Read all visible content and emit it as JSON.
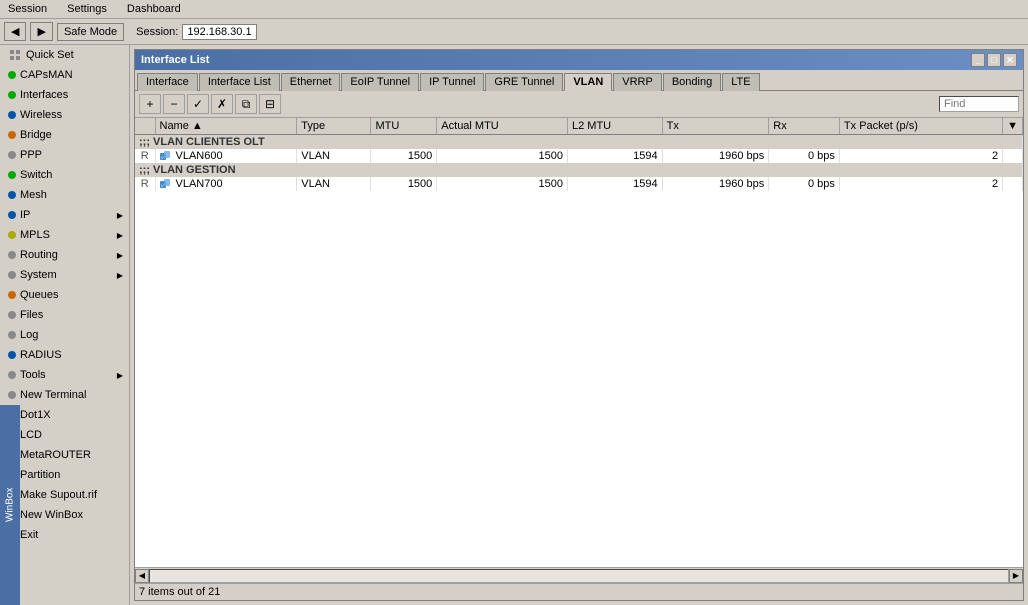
{
  "menuBar": {
    "items": [
      "Session",
      "Settings",
      "Dashboard"
    ]
  },
  "toolbar": {
    "backBtn": "◀",
    "forwardBtn": "▶",
    "safeModeBtn": "Safe Mode",
    "sessionLabel": "Session:",
    "sessionValue": "192.168.30.1"
  },
  "sidebar": {
    "items": [
      {
        "id": "quick-set",
        "label": "Quick Set",
        "color": "gray",
        "hasArrow": false
      },
      {
        "id": "capsman",
        "label": "CAPsMAN",
        "color": "green",
        "hasArrow": false
      },
      {
        "id": "interfaces",
        "label": "Interfaces",
        "color": "green",
        "hasArrow": false
      },
      {
        "id": "wireless",
        "label": "Wireless",
        "color": "blue",
        "hasArrow": false
      },
      {
        "id": "bridge",
        "label": "Bridge",
        "color": "orange",
        "hasArrow": false
      },
      {
        "id": "ppp",
        "label": "PPP",
        "color": "gray",
        "hasArrow": false
      },
      {
        "id": "switch",
        "label": "Switch",
        "color": "green",
        "hasArrow": false
      },
      {
        "id": "mesh",
        "label": "Mesh",
        "color": "blue",
        "hasArrow": false
      },
      {
        "id": "ip",
        "label": "IP",
        "color": "blue",
        "hasArrow": true
      },
      {
        "id": "mpls",
        "label": "MPLS",
        "color": "yellow",
        "hasArrow": true
      },
      {
        "id": "routing",
        "label": "Routing",
        "color": "gray",
        "hasArrow": true
      },
      {
        "id": "system",
        "label": "System",
        "color": "gray",
        "hasArrow": true
      },
      {
        "id": "queues",
        "label": "Queues",
        "color": "orange",
        "hasArrow": false
      },
      {
        "id": "files",
        "label": "Files",
        "color": "gray",
        "hasArrow": false
      },
      {
        "id": "log",
        "label": "Log",
        "color": "gray",
        "hasArrow": false
      },
      {
        "id": "radius",
        "label": "RADIUS",
        "color": "blue",
        "hasArrow": false
      },
      {
        "id": "tools",
        "label": "Tools",
        "color": "gray",
        "hasArrow": true
      },
      {
        "id": "new-terminal",
        "label": "New Terminal",
        "color": "gray",
        "hasArrow": false
      },
      {
        "id": "dot1x",
        "label": "Dot1X",
        "color": "gray",
        "hasArrow": false
      },
      {
        "id": "lcd",
        "label": "LCD",
        "color": "gray",
        "hasArrow": false
      },
      {
        "id": "metarouter",
        "label": "MetaROUTER",
        "color": "gray",
        "hasArrow": false
      },
      {
        "id": "partition",
        "label": "Partition",
        "color": "gray",
        "hasArrow": false
      },
      {
        "id": "make-supout",
        "label": "Make Supout.rif",
        "color": "gray",
        "hasArrow": false
      },
      {
        "id": "new-winbox",
        "label": "New WinBox",
        "color": "blue",
        "hasArrow": false
      },
      {
        "id": "exit",
        "label": "Exit",
        "color": "red",
        "hasArrow": false
      }
    ],
    "winboxLabel": "WinBox"
  },
  "window": {
    "title": "Interface List",
    "tabs": [
      {
        "id": "interface",
        "label": "Interface"
      },
      {
        "id": "interface-list",
        "label": "Interface List"
      },
      {
        "id": "ethernet",
        "label": "Ethernet"
      },
      {
        "id": "eoip-tunnel",
        "label": "EoIP Tunnel"
      },
      {
        "id": "ip-tunnel",
        "label": "IP Tunnel"
      },
      {
        "id": "gre-tunnel",
        "label": "GRE Tunnel"
      },
      {
        "id": "vlan",
        "label": "VLAN",
        "active": true
      },
      {
        "id": "vrrp",
        "label": "VRRP"
      },
      {
        "id": "bonding",
        "label": "Bonding"
      },
      {
        "id": "lte",
        "label": "LTE"
      }
    ],
    "toolbar": {
      "addBtn": "+",
      "removeBtn": "−",
      "enableBtn": "✓",
      "disableBtn": "✗",
      "copyBtn": "⧉",
      "filterBtn": "⊟",
      "findPlaceholder": "Find"
    },
    "table": {
      "columns": [
        "",
        "Name",
        "Type",
        "MTU",
        "Actual MTU",
        "L2 MTU",
        "Tx",
        "Rx",
        "Tx Packet (p/s)",
        ""
      ],
      "sections": [
        {
          "header": ";;; VLAN CLIENTES OLT",
          "rows": [
            {
              "flag": "R",
              "name": "VLAN600",
              "type": "VLAN",
              "mtu": "1500",
              "actualMtu": "1500",
              "l2mtu": "1594",
              "tx": "1960 bps",
              "rx": "0 bps",
              "txPacket": "2"
            }
          ]
        },
        {
          "header": ";;; VLAN GESTION",
          "rows": [
            {
              "flag": "R",
              "name": "VLAN700",
              "type": "VLAN",
              "mtu": "1500",
              "actualMtu": "1500",
              "l2mtu": "1594",
              "tx": "1960 bps",
              "rx": "0 bps",
              "txPacket": "2"
            }
          ]
        }
      ]
    },
    "statusBar": "7 items out of 21"
  }
}
